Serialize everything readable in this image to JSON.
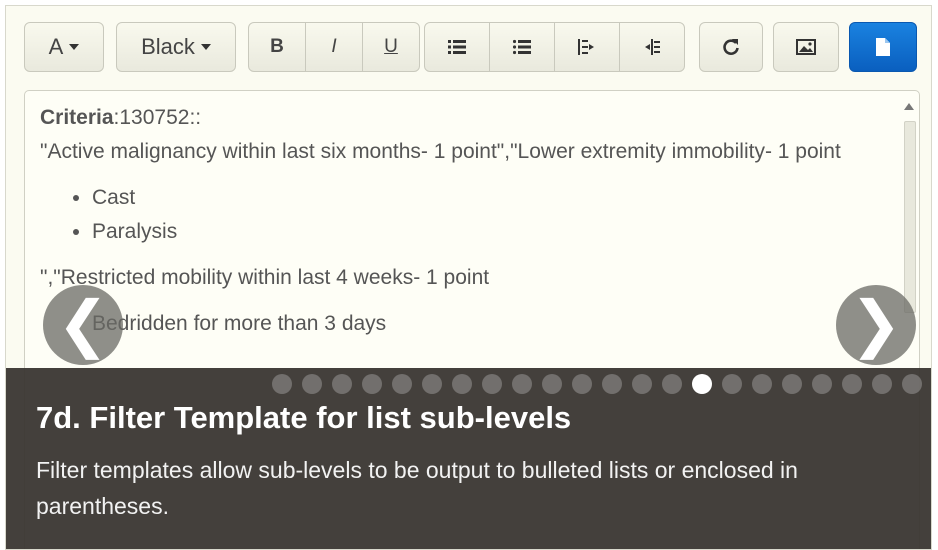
{
  "toolbar": {
    "font_label": "A",
    "color_label": "Black",
    "bold_label": "B",
    "italic_label": "I",
    "underline_label": "U",
    "icons": [
      "ordered-list-icon",
      "bulleted-list-icon",
      "indent-icon",
      "outdent-icon",
      "refresh-icon",
      "image-icon",
      "document-icon"
    ]
  },
  "editor": {
    "line1_bold": "Criteria",
    "line1_rest": ":130752::",
    "line2": "\"Active malignancy within last six months- 1 point\",\"Lower extremity immobility- 1 point",
    "bullets": [
      "Cast",
      "Paralysis"
    ],
    "line3": "\",\"Restricted mobility within last 4 weeks- 1 point",
    "bullets2": [
      "Bedridden for more than 3 days"
    ]
  },
  "carousel": {
    "prev_glyph": "❮",
    "next_glyph": "❯",
    "slide_count": 22,
    "active_index": 14,
    "title": "7d. Filter Template for list sub-levels",
    "description": "Filter templates allow sub-levels to be output to bulleted lists or enclosed in parentheses."
  },
  "colors": {
    "primary_button": "#0a5fbf",
    "caption_bg": "#38342f"
  }
}
